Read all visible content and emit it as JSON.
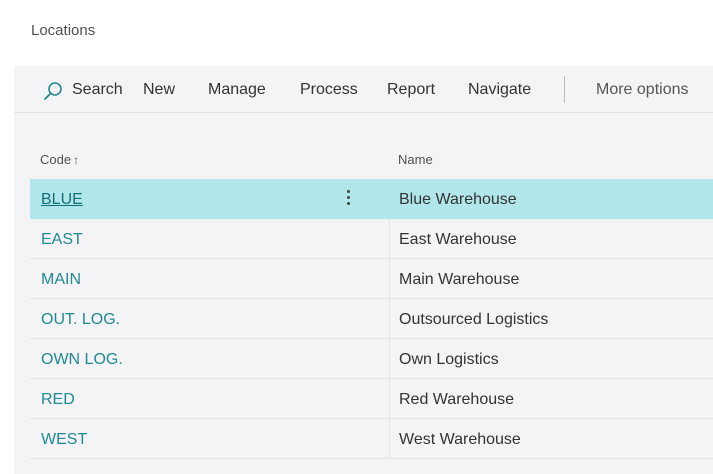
{
  "page": {
    "title": "Locations"
  },
  "actionbar": {
    "search_label": "Search",
    "new_label": "New",
    "manage_label": "Manage",
    "process_label": "Process",
    "report_label": "Report",
    "navigate_label": "Navigate",
    "more_options_label": "More options",
    "search_icon": "search-icon",
    "accent_color": "#1f8a92"
  },
  "table": {
    "columns": {
      "code": "Code",
      "name": "Name",
      "sort_indicator": "↑"
    },
    "rows": [
      {
        "code": "BLUE",
        "name": "Blue Warehouse",
        "selected": true
      },
      {
        "code": "EAST",
        "name": "East Warehouse"
      },
      {
        "code": "MAIN",
        "name": "Main Warehouse"
      },
      {
        "code": "OUT. LOG.",
        "name": "Outsourced Logistics"
      },
      {
        "code": "OWN LOG.",
        "name": "Own Logistics"
      },
      {
        "code": "RED",
        "name": "Red Warehouse"
      },
      {
        "code": "WEST",
        "name": "West Warehouse"
      }
    ],
    "selected_row_color": "#b1e6ea"
  }
}
